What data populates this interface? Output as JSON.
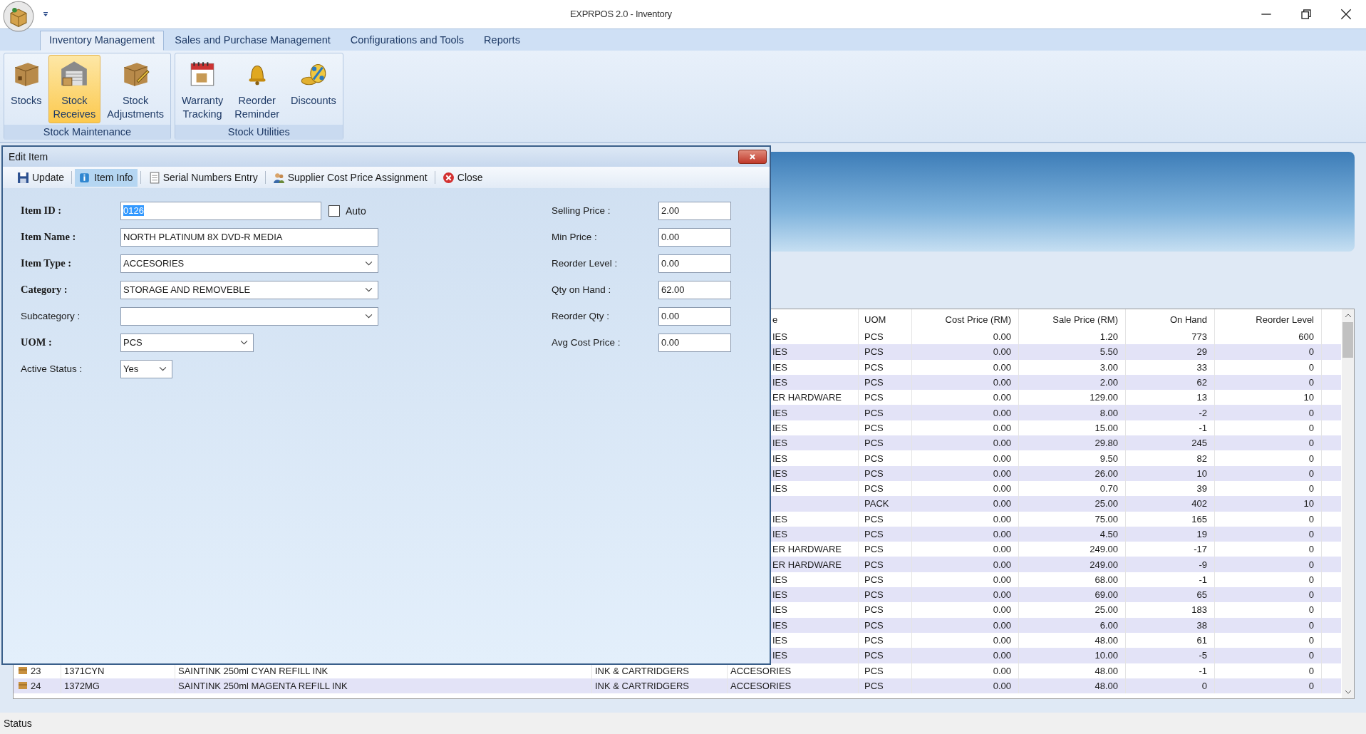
{
  "window": {
    "title": "EXPRPOS 2.0 - Inventory"
  },
  "ribbon": {
    "tabs": [
      {
        "label": "Inventory Management",
        "selected": true
      },
      {
        "label": "Sales and Purchase Management",
        "selected": false
      },
      {
        "label": "Configurations and Tools",
        "selected": false
      },
      {
        "label": "Reports",
        "selected": false
      }
    ],
    "groups": [
      {
        "label": "Stock Maintenance",
        "buttons": [
          {
            "label": "Stocks",
            "selected": false
          },
          {
            "label": "Stock Receives",
            "selected": true
          },
          {
            "label": "Stock Adjustments",
            "selected": false
          }
        ]
      },
      {
        "label": "Stock Utilities",
        "buttons": [
          {
            "label": "Warranty Tracking",
            "selected": false
          },
          {
            "label": "Reorder Reminder",
            "selected": false
          },
          {
            "label": "Discounts",
            "selected": false
          }
        ]
      }
    ]
  },
  "dialog": {
    "title": "Edit Item",
    "toolbar": [
      {
        "label": "Update",
        "selected": false
      },
      {
        "label": "Item Info",
        "selected": true
      },
      {
        "label": "Serial Numbers Entry",
        "selected": false
      },
      {
        "label": "Supplier Cost Price Assignment",
        "selected": false
      },
      {
        "label": "Close",
        "selected": false
      }
    ],
    "left_fields": [
      {
        "label": "Item ID :",
        "kind": "text",
        "value": "0126",
        "bold": true,
        "highlighted": true
      },
      {
        "label": "Item Name :",
        "kind": "text",
        "value": "NORTH PLATINUM 8X DVD-R MEDIA",
        "bold": true
      },
      {
        "label": "Item Type :",
        "kind": "combo",
        "value": "ACCESORIES",
        "bold": true
      },
      {
        "label": "Category :",
        "kind": "combo",
        "value": "STORAGE AND REMOVEBLE",
        "bold": true
      },
      {
        "label": "Subcategory :",
        "kind": "combo",
        "bold": false
      },
      {
        "label": "UOM :",
        "kind": "combo",
        "value": "PCS",
        "bold": true
      },
      {
        "label": "Active Status :",
        "kind": "combo",
        "value": "Yes",
        "bold": false
      }
    ],
    "auto": {
      "label": "Auto",
      "checked": false
    },
    "right_fields": [
      {
        "label": "Selling Price :",
        "value": "2.00"
      },
      {
        "label": "Min Price :",
        "value": "0.00"
      },
      {
        "label": "Reorder Level :",
        "value": "0.00"
      },
      {
        "label": "Qty on Hand :",
        "value": "62.00"
      },
      {
        "label": "Reorder Qty :",
        "value": "0.00"
      },
      {
        "label": "Avg Cost Price :",
        "value": "0.00"
      }
    ]
  },
  "grid": {
    "columns": [
      "e",
      "UOM",
      "Cost Price (RM)",
      "Sale Price (RM)",
      "On Hand",
      "Reorder Level"
    ],
    "rows": [
      {
        "type": "IES",
        "uom": "PCS",
        "cost": "0.00",
        "sale": "1.20",
        "on_hand": "773",
        "reorder": "600"
      },
      {
        "type": "IES",
        "uom": "PCS",
        "cost": "0.00",
        "sale": "5.50",
        "on_hand": "29",
        "reorder": "0"
      },
      {
        "type": "IES",
        "uom": "PCS",
        "cost": "0.00",
        "sale": "3.00",
        "on_hand": "33",
        "reorder": "0"
      },
      {
        "type": "IES",
        "uom": "PCS",
        "cost": "0.00",
        "sale": "2.00",
        "on_hand": "62",
        "reorder": "0"
      },
      {
        "type": "ER HARDWARE",
        "uom": "PCS",
        "cost": "0.00",
        "sale": "129.00",
        "on_hand": "13",
        "reorder": "10"
      },
      {
        "type": "IES",
        "uom": "PCS",
        "cost": "0.00",
        "sale": "8.00",
        "on_hand": "-2",
        "reorder": "0"
      },
      {
        "type": "IES",
        "uom": "PCS",
        "cost": "0.00",
        "sale": "15.00",
        "on_hand": "-1",
        "reorder": "0"
      },
      {
        "type": "IES",
        "uom": "PCS",
        "cost": "0.00",
        "sale": "29.80",
        "on_hand": "245",
        "reorder": "0"
      },
      {
        "type": "IES",
        "uom": "PCS",
        "cost": "0.00",
        "sale": "9.50",
        "on_hand": "82",
        "reorder": "0"
      },
      {
        "type": "IES",
        "uom": "PCS",
        "cost": "0.00",
        "sale": "26.00",
        "on_hand": "10",
        "reorder": "0"
      },
      {
        "type": "IES",
        "uom": "PCS",
        "cost": "0.00",
        "sale": "0.70",
        "on_hand": "39",
        "reorder": "0"
      },
      {
        "uom": "PACK",
        "cost": "0.00",
        "sale": "25.00",
        "on_hand": "402",
        "reorder": "10"
      },
      {
        "type": "IES",
        "uom": "PCS",
        "cost": "0.00",
        "sale": "75.00",
        "on_hand": "165",
        "reorder": "0"
      },
      {
        "type": "IES",
        "uom": "PCS",
        "cost": "0.00",
        "sale": "4.50",
        "on_hand": "19",
        "reorder": "0"
      },
      {
        "type": "ER HARDWARE",
        "uom": "PCS",
        "cost": "0.00",
        "sale": "249.00",
        "on_hand": "-17",
        "reorder": "0"
      },
      {
        "type": "ER HARDWARE",
        "uom": "PCS",
        "cost": "0.00",
        "sale": "249.00",
        "on_hand": "-9",
        "reorder": "0"
      },
      {
        "type": "IES",
        "uom": "PCS",
        "cost": "0.00",
        "sale": "68.00",
        "on_hand": "-1",
        "reorder": "0"
      },
      {
        "type": "IES",
        "uom": "PCS",
        "cost": "0.00",
        "sale": "69.00",
        "on_hand": "65",
        "reorder": "0"
      },
      {
        "type": "IES",
        "uom": "PCS",
        "cost": "0.00",
        "sale": "25.00",
        "on_hand": "183",
        "reorder": "0"
      },
      {
        "type": "IES",
        "uom": "PCS",
        "cost": "0.00",
        "sale": "6.00",
        "on_hand": "38",
        "reorder": "0"
      },
      {
        "type": "IES",
        "uom": "PCS",
        "cost": "0.00",
        "sale": "48.00",
        "on_hand": "61",
        "reorder": "0"
      },
      {
        "type": "IES",
        "uom": "PCS",
        "cost": "0.00",
        "sale": "10.00",
        "on_hand": "-5",
        "reorder": "0"
      },
      {
        "no": "23",
        "code": "1371CYN",
        "description": "SAINTINK 250ml CYAN REFILL INK",
        "category": "INK & CARTRIDGERS",
        "type": "ACCESORIES",
        "uom": "PCS",
        "cost": "0.00",
        "sale": "48.00",
        "on_hand": "-1",
        "reorder": "0"
      },
      {
        "no": "24",
        "code": "1372MG",
        "description": "SAINTINK 250ml MAGENTA REFILL INK",
        "category": "INK & CARTRIDGERS",
        "type": "ACCESORIES",
        "uom": "PCS",
        "cost": "0.00",
        "sale": "48.00",
        "on_hand": "0",
        "reorder": "0"
      }
    ]
  },
  "status_bar": {
    "text": "Status"
  }
}
